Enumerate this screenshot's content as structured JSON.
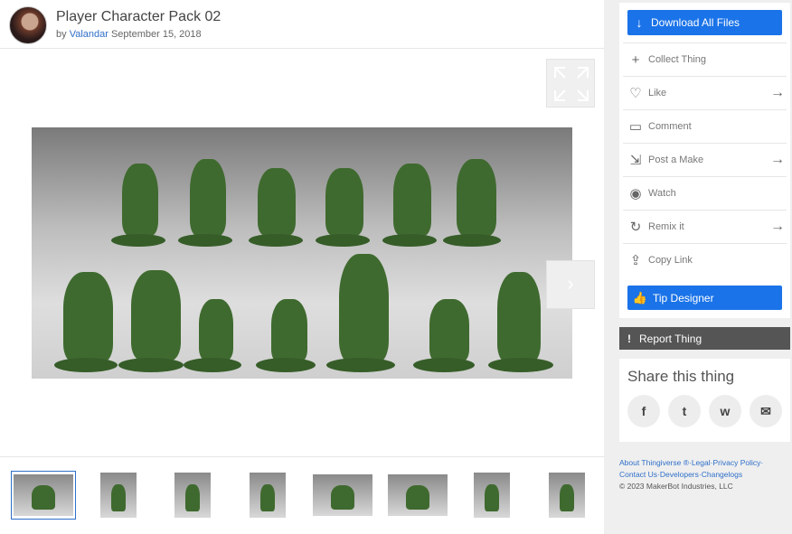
{
  "thing": {
    "title": "Player Character Pack 02",
    "by": "by",
    "author": "Valandar",
    "date": "September 15, 2018"
  },
  "viewer": {
    "next_glyph": "›"
  },
  "thumbnails": [
    {
      "alt": "group"
    },
    {
      "alt": "figure 1"
    },
    {
      "alt": "figure 2"
    },
    {
      "alt": "figure 3"
    },
    {
      "alt": "figures 4"
    },
    {
      "alt": "figures 5"
    },
    {
      "alt": "figure 6"
    },
    {
      "alt": "figure 7"
    }
  ],
  "actions": {
    "download": "Download All Files",
    "collect": "Collect Thing",
    "like": "Like",
    "comment": "Comment",
    "post_make": "Post a Make",
    "watch": "Watch",
    "remix": "Remix it",
    "copy_link": "Copy Link",
    "tip": "Tip Designer",
    "report": "Report Thing",
    "report_glyph": "!"
  },
  "share": {
    "title": "Share this thing",
    "facebook": "f",
    "twitter": "t",
    "whatsapp": "w",
    "email": "✉"
  },
  "footer": {
    "about": "About Thingiverse ®",
    "legal": "Legal",
    "privacy": "Privacy Policy",
    "contact": "Contact Us",
    "developers": "Developers",
    "changelogs": "Changelogs",
    "copyright": "©  2023 MakerBot Industries, LLC"
  },
  "colors": {
    "accent": "#1a73e8",
    "link": "#2f6fc9",
    "report": "#555555",
    "miniature": "#3f6a2f"
  }
}
